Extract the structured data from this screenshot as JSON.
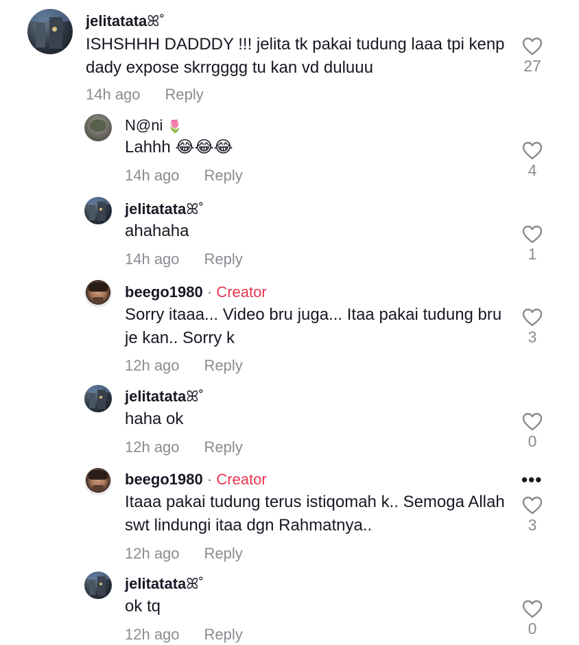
{
  "comments": [
    {
      "username": "jelitatata",
      "username_suffix": "ꕤ˚",
      "text": "ISHSHHH DADDDY !!! jelita tk pakai tudung laaa tpi kenp dady expose skrrgggg tu kan vd duluuu",
      "time": "14h ago",
      "reply_label": "Reply",
      "likes": "27"
    },
    {
      "username": "N@ni",
      "emoji": "🌷",
      "text": "Lahhh 😂😂😂",
      "time": "14h ago",
      "reply_label": "Reply",
      "likes": "4"
    },
    {
      "username": "jelitatata",
      "username_suffix": "ꕤ˚",
      "text": "ahahaha",
      "time": "14h ago",
      "reply_label": "Reply",
      "likes": "1"
    },
    {
      "username": "beego1980",
      "separator": "·",
      "badge": "Creator",
      "text": "Sorry itaaa... Video bru juga... Itaa pakai tudung bru je kan.. Sorry k",
      "time": "12h ago",
      "reply_label": "Reply",
      "likes": "3"
    },
    {
      "username": "jelitatata",
      "username_suffix": "ꕤ˚",
      "text": "haha ok",
      "time": "12h ago",
      "reply_label": "Reply",
      "likes": "0"
    },
    {
      "username": "beego1980",
      "separator": "·",
      "badge": "Creator",
      "text": "Itaaa pakai tudung terus istiqomah k.. Semoga Allah swt lindungi itaa dgn Rahmatnya..",
      "time": "12h ago",
      "reply_label": "Reply",
      "likes": "3",
      "more_label": "•••"
    },
    {
      "username": "jelitatata",
      "username_suffix": "ꕤ˚",
      "text": "ok tq",
      "time": "12h ago",
      "reply_label": "Reply",
      "likes": "0"
    }
  ]
}
